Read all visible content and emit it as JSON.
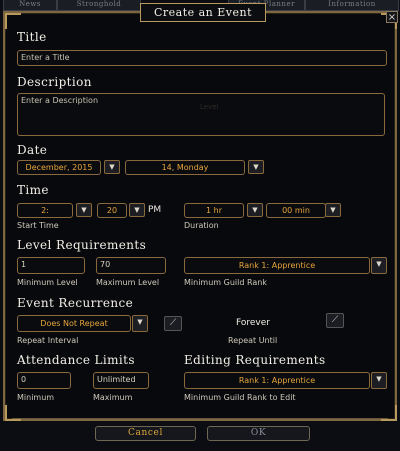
{
  "window": {
    "title": "Create an Event",
    "close_glyph": "×"
  },
  "background_tabs": [
    "News",
    "Stronghold",
    "Event Planner",
    "Information"
  ],
  "title_section": {
    "heading": "Title",
    "placeholder": "Enter a Title"
  },
  "description_section": {
    "heading": "Description",
    "placeholder": "Enter a Description",
    "watermark": "Level"
  },
  "date_section": {
    "heading": "Date",
    "month": "December, 2015",
    "day": "14, Monday"
  },
  "time_section": {
    "heading": "Time",
    "hour": "2:",
    "minute": "20",
    "ampm": "PM",
    "duration": "1 hr",
    "duration_min": "00 min",
    "start_label": "Start Time",
    "duration_label": "Duration"
  },
  "level_section": {
    "heading": "Level Requirements",
    "min_level": "1",
    "max_level": "70",
    "min_label": "Minimum Level",
    "max_label": "Maximum Level",
    "guild_rank": "Rank 1: Apprentice",
    "guild_rank_label": "Minimum Guild Rank"
  },
  "recurrence_section": {
    "heading": "Event Recurrence",
    "interval": "Does Not Repeat",
    "interval_label": "Repeat Interval",
    "until_value": "Forever",
    "until_label": "Repeat Until"
  },
  "attendance_section": {
    "heading": "Attendance Limits",
    "minimum": "0",
    "maximum": "Unlimited",
    "min_label": "Minimum",
    "max_label": "Maximum"
  },
  "editing_section": {
    "heading": "Editing Requirements",
    "rank": "Rank 1: Apprentice",
    "label": "Minimum Guild Rank to Edit"
  },
  "buttons": {
    "cancel": "Cancel",
    "ok": "OK"
  },
  "colors": {
    "accent": "#e6a53c",
    "border": "#8a6a3c",
    "frame": "#b89a5e",
    "cancel_text": "#e0a83c",
    "ok_text": "#8a8f96"
  },
  "icons": {
    "dropdown": "chevron-down-icon",
    "calendar": "calendar-edit-icon",
    "close": "close-icon"
  }
}
